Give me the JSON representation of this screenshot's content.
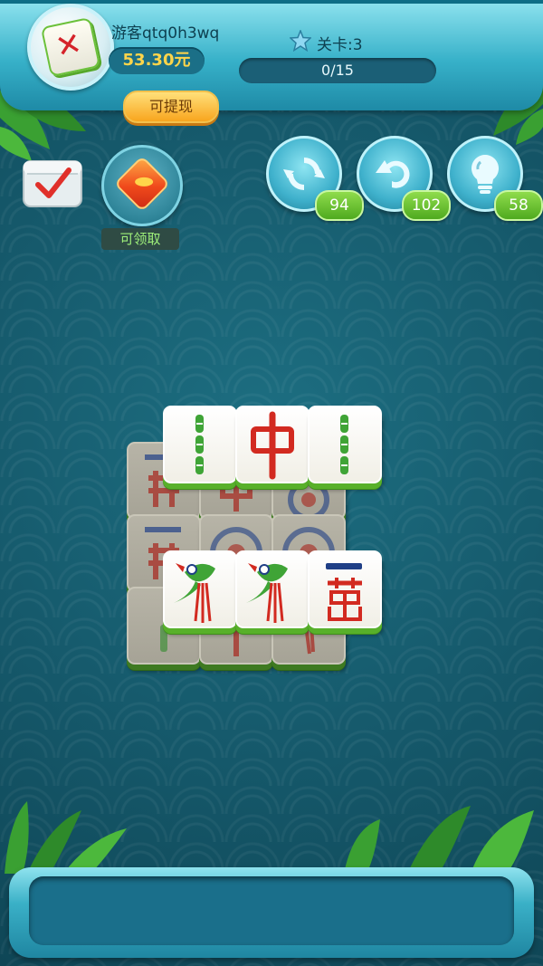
{
  "player": {
    "username": "游客qtq0h3wq",
    "balance": "53.30元",
    "withdraw_label": "可提现"
  },
  "level": {
    "label": "关卡:3",
    "progress_text": "0/15",
    "progress_fraction": 0
  },
  "side": {
    "claim_label": "可领取"
  },
  "tools": {
    "shuffle_count": "94",
    "undo_count": "102",
    "hint_count": "58"
  }
}
